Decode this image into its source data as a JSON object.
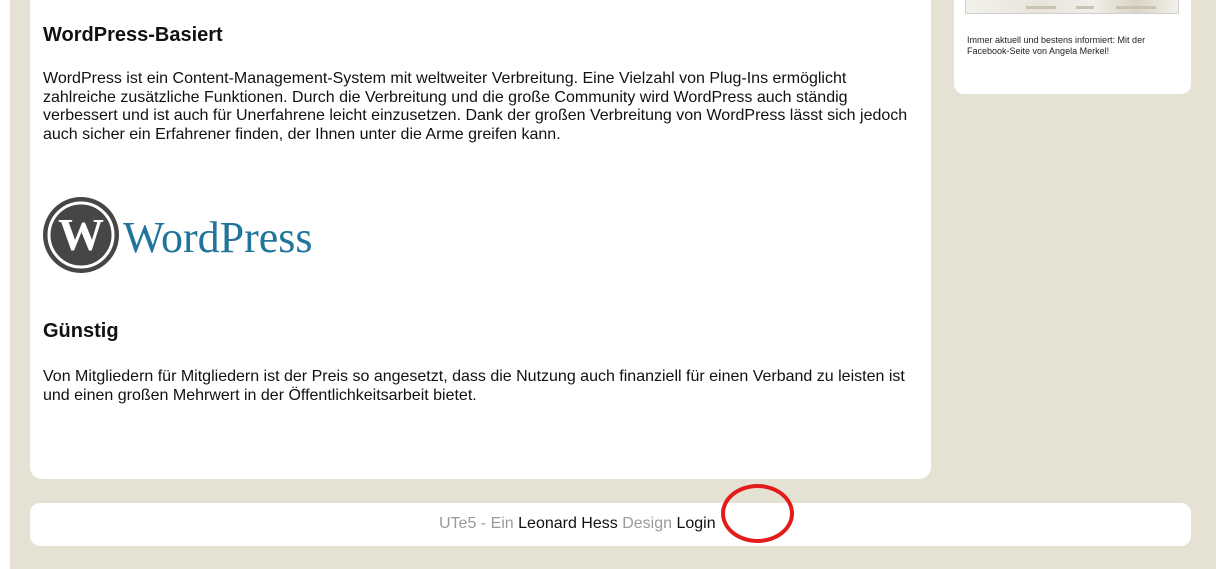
{
  "sections": [
    {
      "heading": "WordPress-Basiert",
      "text": "WordPress ist ein Content-Management-System mit weltweiter Verbreitung. Eine Vielzahl von Plug-Ins ermöglicht zahlreiche zusätzliche Funktionen. Durch die Verbreitung und die große Community wird WordPress auch ständig verbessert und ist auch für Unerfahrene leicht einzusetzen. Dank der großen Verbreitung von WordPress lässt sich jedoch auch sicher ein Erfahrener finden, der Ihnen unter die Arme greifen kann."
    },
    {
      "heading": "Günstig",
      "text": "Von Mitgliedern für Mitgliedern ist der Preis so angesetzt, dass die Nutzung auch finanziell für einen Verband zu leisten ist und einen großen Mehrwert in der Öffentlichkeitsarbeit bietet."
    }
  ],
  "logo": {
    "text": "WordPress",
    "color": "#21759b",
    "mark_color": "#464646"
  },
  "sidebar": {
    "caption": "Immer aktuell und bestens informiert: Mit der Facebook-Seite von Angela Merkel!"
  },
  "footer": {
    "part1": "UTe5 - Ein ",
    "author": "Leonard Hess",
    "part2": " Design ",
    "login": "Login"
  },
  "annotation": {
    "color": "#e31b1b"
  }
}
